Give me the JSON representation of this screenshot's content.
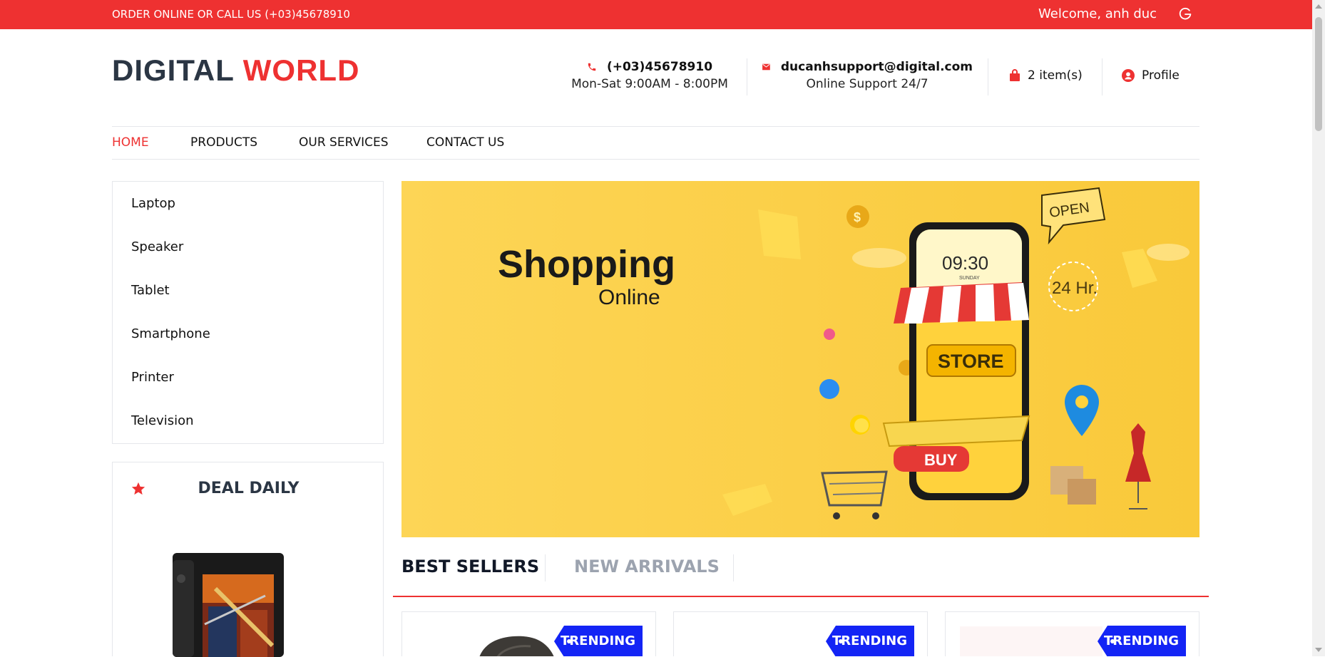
{
  "topbar": {
    "left_text": "ORDER ONLINE OR CALL US (+03)45678910",
    "welcome": "Welcome, anh duc",
    "logout_icon": "logout-icon"
  },
  "logo": {
    "part1": "DIGITAL",
    "part2": "WORLD"
  },
  "contact": {
    "phone": "(+03)45678910",
    "hours": "Mon-Sat 9:00AM - 8:00PM",
    "email": "ducanhsupport@digital.com",
    "support": "Online Support 24/7"
  },
  "cart": {
    "label": "2 item(s)"
  },
  "profile": {
    "label": "Profile"
  },
  "nav": {
    "items": [
      {
        "label": "HOME"
      },
      {
        "label": "PRODUCTS"
      },
      {
        "label": "OUR SERVICES"
      },
      {
        "label": "CONTACT US"
      }
    ]
  },
  "categories": [
    {
      "label": "Laptop"
    },
    {
      "label": "Speaker"
    },
    {
      "label": "Tablet"
    },
    {
      "label": "Smartphone"
    },
    {
      "label": "Printer"
    },
    {
      "label": "Television"
    }
  ],
  "deal": {
    "title": "DEAL DAILY"
  },
  "banner": {
    "title": "Shopping",
    "subtitle": "Online",
    "phone_time": "09:30",
    "phone_day": "SUNDAY",
    "store": "STORE",
    "buy": "BUY",
    "open": "OPEN",
    "hours": "24 Hr."
  },
  "tabs": {
    "best": "BEST SELLERS",
    "new": "NEW ARRIVALS"
  },
  "products": [
    {
      "badge": "TRENDING"
    },
    {
      "badge": "TRENDING"
    },
    {
      "badge": "TRENDING"
    }
  ],
  "colors": {
    "brand": "#ee3131",
    "dark": "#2b3644",
    "banner": "#fccf45",
    "badge": "#1324f5"
  }
}
